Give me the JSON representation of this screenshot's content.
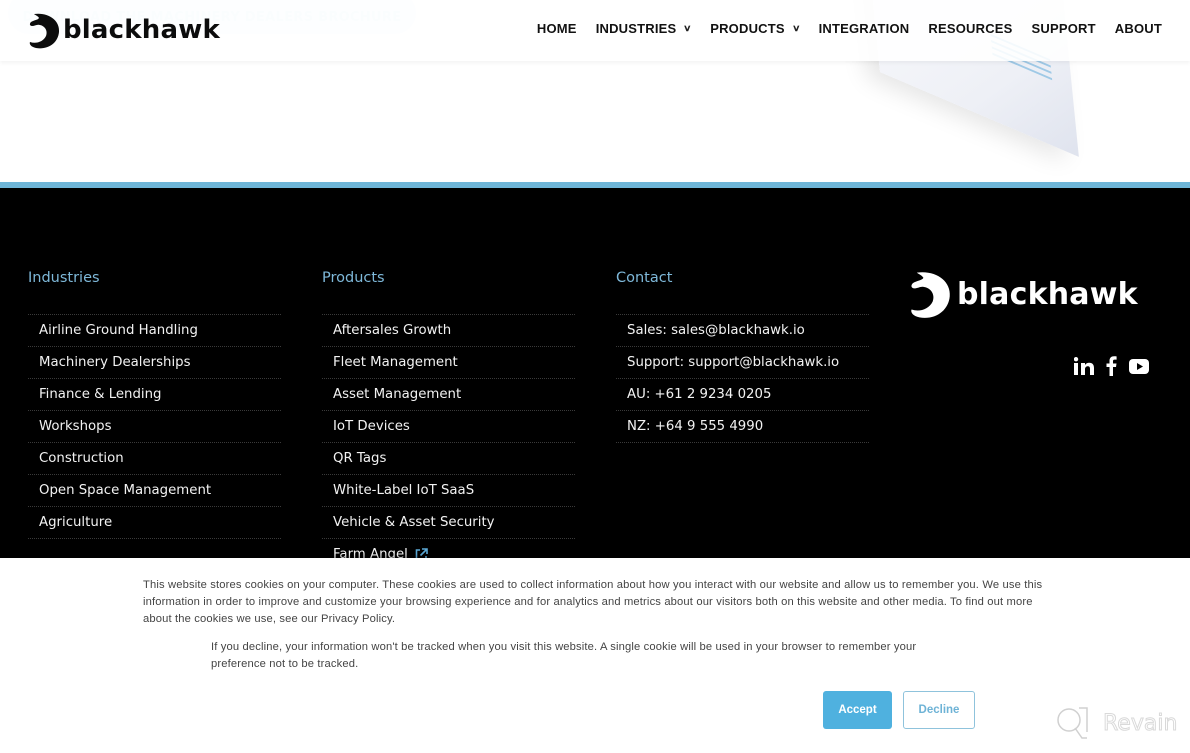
{
  "hero": {
    "brochure_button": "DOWNLOAD THE MACHINERY DEALERS BROCHURE"
  },
  "header": {
    "logo_text": "blackhawk",
    "nav": [
      {
        "label": "HOME",
        "has_dropdown": false
      },
      {
        "label": "INDUSTRIES",
        "has_dropdown": true
      },
      {
        "label": "PRODUCTS",
        "has_dropdown": true
      },
      {
        "label": "INTEGRATION",
        "has_dropdown": false
      },
      {
        "label": "RESOURCES",
        "has_dropdown": false
      },
      {
        "label": "SUPPORT",
        "has_dropdown": false
      },
      {
        "label": "ABOUT",
        "has_dropdown": false
      }
    ],
    "chevron_glyph": "⌄"
  },
  "footer": {
    "industries": {
      "title": "Industries",
      "items": [
        "Airline Ground Handling",
        "Machinery Dealerships",
        "Finance & Lending",
        "Workshops",
        "Construction",
        "Open Space Management",
        "Agriculture"
      ]
    },
    "products": {
      "title": "Products",
      "items": [
        "Aftersales Growth",
        "Fleet Management",
        "Asset Management",
        "IoT Devices",
        "QR Tags",
        "White-Label IoT SaaS",
        "Vehicle & Asset Security",
        "Farm Angel"
      ]
    },
    "contact": {
      "title": "Contact",
      "items": [
        "Sales: sales@blackhawk.io",
        "Support: support@blackhawk.io",
        "AU: +61 2 9234 0205",
        "NZ: +64 9 555 4990"
      ]
    },
    "logo_text": "blackhawk",
    "social": [
      "linkedin-icon",
      "facebook-icon",
      "youtube-icon"
    ]
  },
  "cookie": {
    "text_main": "This website stores cookies on your computer. These cookies are used to collect information about how you interact with our website and allow us to remember you. We use this information in order to improve and customize your browsing experience and for analytics and metrics about our visitors both on this website and other media. To find out more about the cookies we use, see our Privacy Policy.",
    "text_decline": "If you decline, your information won't be tracked when you visit this website. A single cookie will be used in your browser to remember your preference not to be tracked.",
    "accept_label": "Accept",
    "decline_label": "Decline"
  },
  "watermark": {
    "text": "Revain"
  },
  "colors": {
    "accent_blue": "#6fb6d8",
    "heading_blue": "#7eb8d9",
    "accept_blue": "#4fb1df",
    "footer_bg": "#000000"
  }
}
